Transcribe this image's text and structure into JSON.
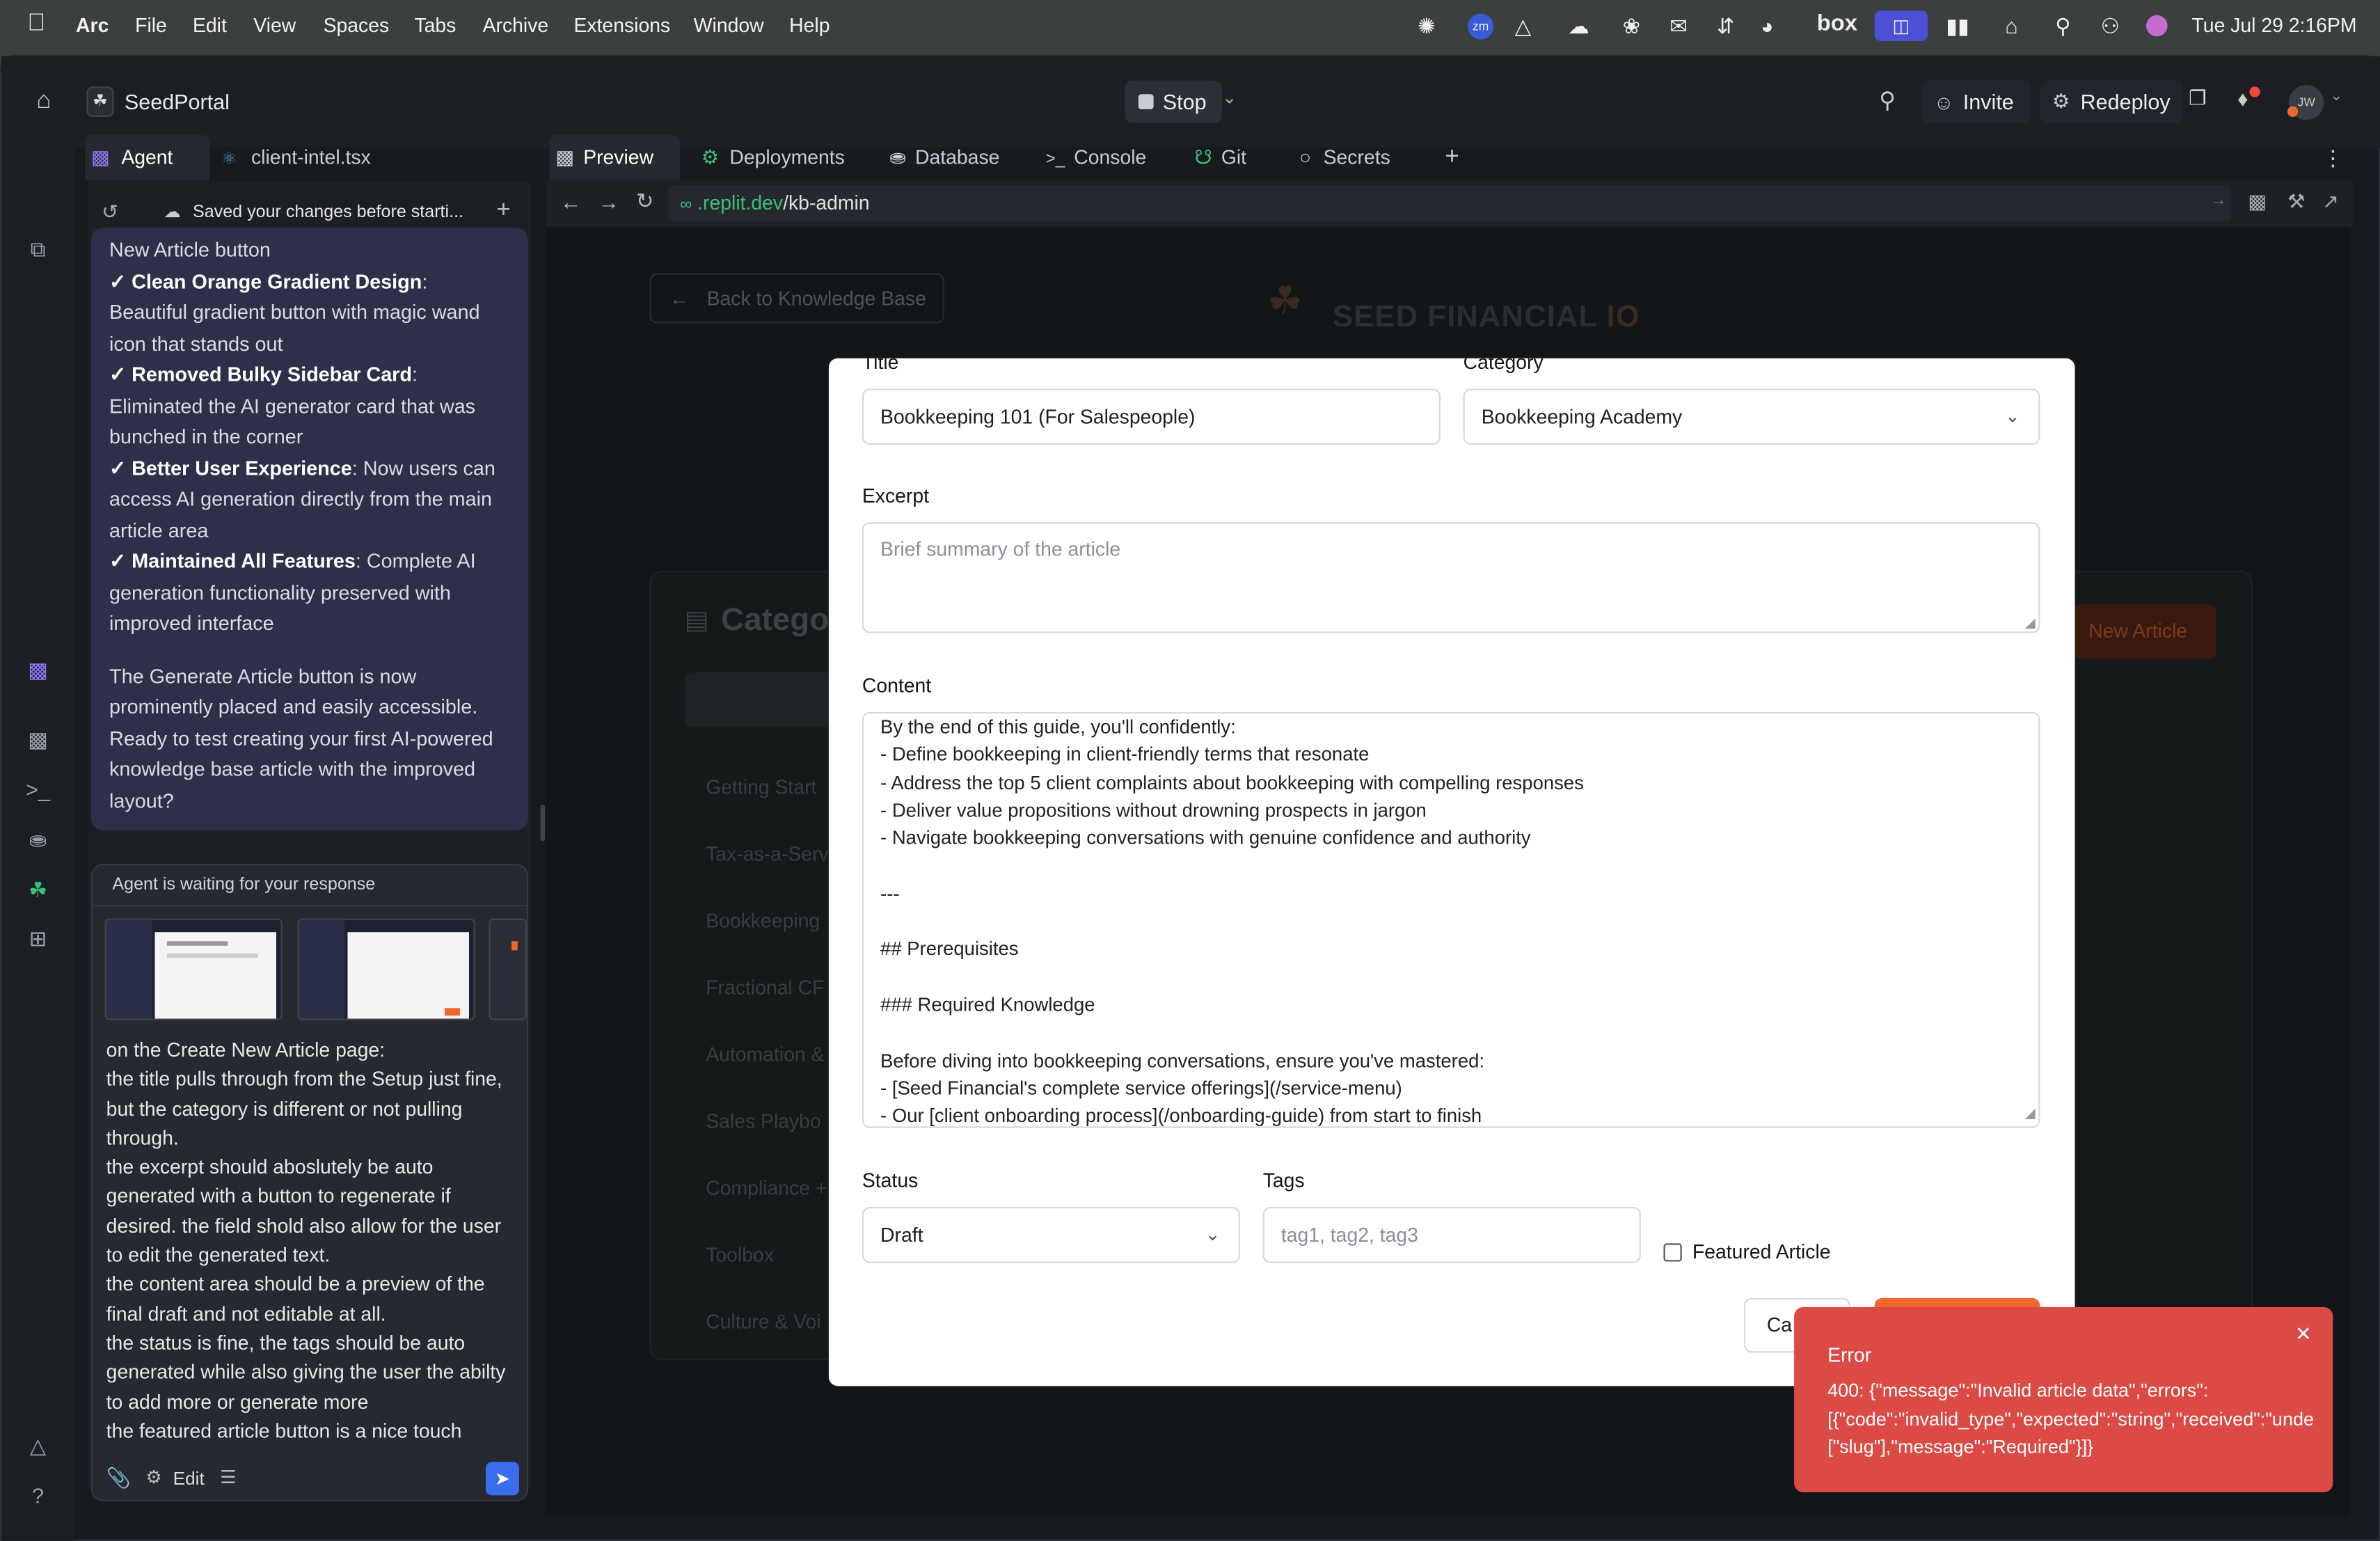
{
  "menubar": {
    "app": "Arc",
    "items": [
      "File",
      "Edit",
      "View",
      "Spaces",
      "Tabs",
      "Archive",
      "Extensions",
      "Window",
      "Help"
    ],
    "clock": "Tue Jul 29  2:16PM",
    "box_label": "box"
  },
  "topbar": {
    "project_name": "SeedPortal",
    "stop_label": "Stop",
    "invite_label": "Invite",
    "redeploy_label": "Redeploy",
    "avatar_initials": "JW"
  },
  "left_tabs": {
    "agent": "Agent",
    "file": "client-intel.tsx"
  },
  "right_tabs": [
    "Preview",
    "Deployments",
    "Database",
    "Console",
    "Git",
    "Secrets"
  ],
  "browser": {
    "url_domain": ".replit.dev",
    "url_path": "/kb-admin"
  },
  "agent": {
    "saved_banner": "Saved your changes before starti...",
    "messages": {
      "line0": "New Article button",
      "b1_title": "✓ Clean Orange Gradient Design",
      "b1_text": ": Beautiful gradient button with magic wand icon that stands out",
      "b2_title": "✓ Removed Bulky Sidebar Card",
      "b2_text": ": Eliminated the AI generator card that was bunched in the corner",
      "b3_title": "✓ Better User Experience",
      "b3_text": ": Now users can access AI generation directly from the main article area",
      "b4_title": "✓ Maintained All Features",
      "b4_text": ": Complete AI generation functionality preserved with improved interface",
      "closing": "The Generate Article button is now prominently placed and easily accessible. Ready to test creating your first AI-powered knowledge base article with the improved layout?"
    },
    "waiting": "Agent is waiting for your response",
    "user_message": [
      "on the Create New Article page:",
      "the title pulls through from the Setup just fine, but the category is different or not pulling through.",
      "the excerpt should aboslutely be auto generated with a button to regenerate if desired. the field shold also allow for the user to edit the generated text.",
      "the content area should be a preview of the final draft and not editable at all.",
      "the status is fine, the tags should be auto generated while also giving the user the abilty to add more or generate more",
      "the featured article button is a nice touch"
    ],
    "edit_label": "Edit"
  },
  "background_page": {
    "back_link": "Back to Knowledge Base",
    "brand": "SEED FINANCIAL",
    "brand_suffix": "IO",
    "categories_heading": "Catego",
    "new_article_btn": "New Article",
    "categories": [
      "Getting Start",
      "Tax-as-a-Serv",
      "Bookkeeping",
      "Fractional CF",
      "Automation &",
      "Sales Playbo",
      "Compliance +",
      "Toolbox",
      "Culture & Voi"
    ]
  },
  "form": {
    "title_label": "Title",
    "title_value": "Bookkeeping 101 (For Salespeople)",
    "category_label": "Category",
    "category_value": "Bookkeeping Academy",
    "excerpt_label": "Excerpt",
    "excerpt_placeholder": "Brief summary of the article",
    "content_label": "Content",
    "content_lines": [
      "By the end of this guide, you'll confidently:",
      "- Define bookkeeping in client-friendly terms that resonate",
      "- Address the top 5 client complaints about bookkeeping with compelling responses",
      "- Deliver value propositions without drowning prospects in jargon",
      "- Navigate bookkeeping conversations with genuine confidence and authority",
      "",
      "---",
      "",
      "## Prerequisites",
      "",
      "### Required Knowledge",
      "",
      "Before diving into bookkeeping conversations, ensure you've mastered:",
      "- [Seed Financial's complete service offerings](/service-menu)",
      "- Our [client onboarding process](/onboarding-guide) from start to finish"
    ],
    "status_label": "Status",
    "status_value": "Draft",
    "tags_label": "Tags",
    "tags_placeholder": "tag1, tag2, tag3",
    "featured_label": "Featured Article",
    "cancel_label": "Ca"
  },
  "toast": {
    "title": "Error",
    "line1": "400: {\"message\":\"Invalid article data\",\"errors\":",
    "line2": "[{\"code\":\"invalid_type\",\"expected\":\"string\",\"received\":\"unde",
    "line3": "[\"slug\"],\"message\":\"Required\"}]}"
  },
  "colors": {
    "accent_orange": "#f0672e",
    "error_red": "#dc4a45",
    "bubble_bg": "#2e3049",
    "send_blue": "#3a6df0"
  }
}
